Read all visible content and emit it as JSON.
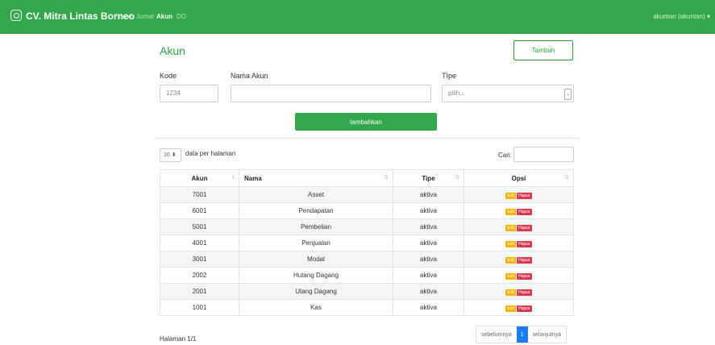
{
  "navbar": {
    "brand": "CV. Mitra Lintas Borneo",
    "links": [
      "Home",
      "Jurnal",
      "Akun",
      "DO"
    ],
    "active": "Akun",
    "user": "akuntan (akuntan)"
  },
  "page": {
    "title": "Akun",
    "add_button": "Tambah"
  },
  "form": {
    "kode_label": "Kode",
    "kode_placeholder": "1234",
    "nama_label": "Nama Akun",
    "nama_placeholder": "",
    "tipe_label": "TIpe",
    "tipe_value": "pilih...",
    "submit": "tambahkan"
  },
  "table_controls": {
    "length": "10",
    "length_text": "data per halaman",
    "search_label": "Cari:"
  },
  "chart_data": {
    "type": "table",
    "columns": [
      "Akun",
      "Nama",
      "Tipe",
      "Opsi"
    ],
    "rows": [
      [
        "7001",
        "Asset",
        "aktiva"
      ],
      [
        "6001",
        "Pendapatan",
        "aktiva"
      ],
      [
        "5001",
        "Pembelian",
        "aktiva"
      ],
      [
        "4001",
        "Penjualan",
        "aktiva"
      ],
      [
        "3001",
        "Modal",
        "aktiva"
      ],
      [
        "2002",
        "Hutang Dagang",
        "aktiva"
      ],
      [
        "2001",
        "Utang Dagang",
        "aktiva"
      ],
      [
        "1001",
        "Kas",
        "aktiva"
      ]
    ],
    "actions": [
      "Edit",
      "Hapus"
    ]
  },
  "footer": {
    "info": "Halaman 1/1",
    "prev": "sebelumnya",
    "page": "1",
    "next": "selanjutnya"
  }
}
